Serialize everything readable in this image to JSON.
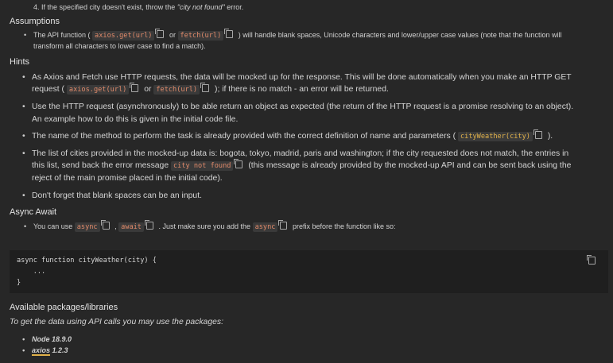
{
  "top_item": {
    "prefix": "4. If the specified city doesn't exist, throw the ",
    "quote": "\"city not found\"",
    "suffix": " error."
  },
  "assumptions": {
    "heading": "Assumptions",
    "item_part1": "The API function ( ",
    "code1": "axios.get(url)",
    "or": " or ",
    "code2": "fetch(url)",
    "item_part2": " ) will handle blank spaces, Unicode characters and lower/upper case values (note that the function will",
    "item_line2": "transform all characters to lower case to find a match)."
  },
  "hints": {
    "heading": "Hints",
    "item1_a": "As Axios and Fetch use HTTP requests, the data will be mocked up for the response. This will be done automatically when you make an HTTP GET",
    "item1_b": "request ( ",
    "item1_code1": "axios.get(url)",
    "item1_or": " or ",
    "item1_code2": "fetch(url)",
    "item1_c": " ); if there is no match - an error will be returned.",
    "item2_a": "Use the HTTP request (asynchronously) to be able return an object as expected (the return of the HTTP request is a promise resolving to an object).",
    "item2_b": "An example how to do this is given in the initial code file.",
    "item3_a": "The name of the method to perform the task is already provided with the correct definition of name and parameters ( ",
    "item3_code": "cityWeather(city)",
    "item3_b": " ).",
    "item4_a": "The list of cities provided in the mocked-up data is: bogota, tokyo, madrid, paris and washington; if the city requested does not match, the entries in",
    "item4_b": "this list, send back the error message ",
    "item4_code": "city not found",
    "item4_c": " (this message is already provided by the mocked-up API and can be sent back using the",
    "item4_d": "reject of the main promise placed in the initial code).",
    "item5": "Don't forget that blank spaces can be an input."
  },
  "async_await": {
    "heading": "Async Await",
    "item_a": "You can use ",
    "code_async": "async",
    "comma": " , ",
    "code_await": "await",
    "item_b": " . Just make sure you add the ",
    "code_async2": "async",
    "item_c": " prefix before the function like so:"
  },
  "code_block": {
    "line1": "async function cityWeather(city) {",
    "line2": "    ...",
    "line3": "}"
  },
  "packages": {
    "heading": "Available packages/libraries",
    "intro": "To get the data using API calls you may use the packages:",
    "item1": "Node 18.9.0",
    "item2_name": "axios",
    "item2_version": " 1.2.3"
  },
  "icons": {
    "copy": "copy-icon"
  },
  "colors": {
    "background": "#272727",
    "inline_code": "#e08a6a",
    "inline_code_yellow": "#e0b14a",
    "code_block_bg": "#1f1f1f"
  }
}
